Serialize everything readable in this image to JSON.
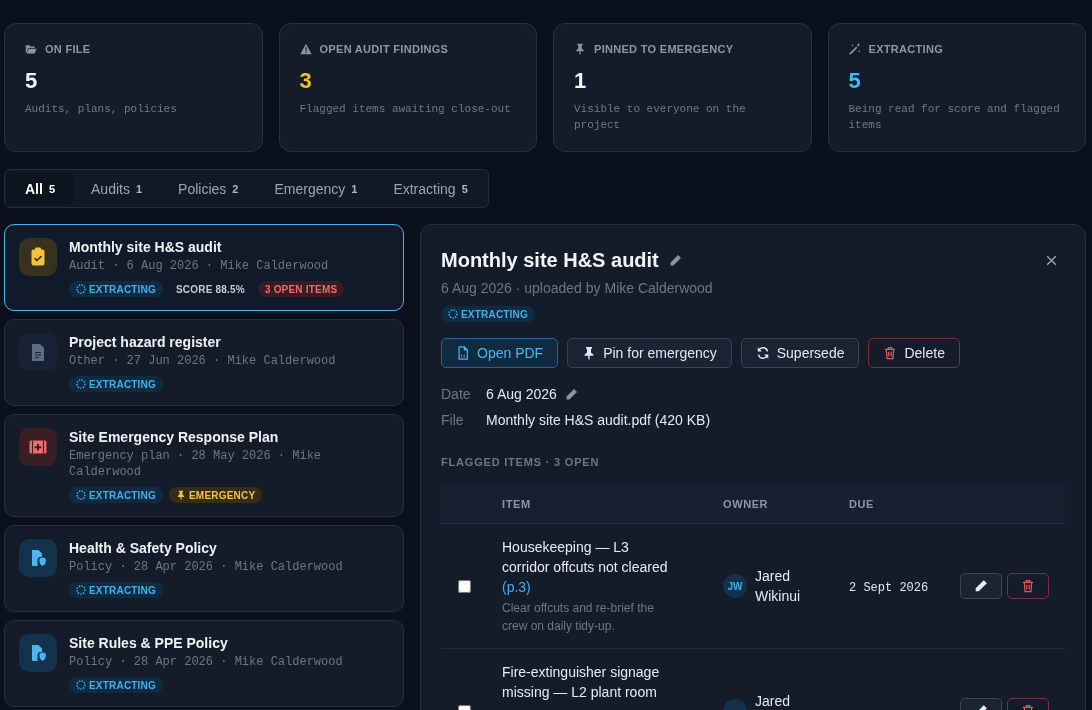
{
  "stats": [
    {
      "kind": "folder",
      "label": "ON FILE",
      "value": "5",
      "color": "#f1f5f9",
      "description": "Audits, plans, policies"
    },
    {
      "kind": "warning",
      "label": "OPEN AUDIT FINDINGS",
      "value": "3",
      "color": "#fbbf24",
      "description": "Flagged items awaiting close-out"
    },
    {
      "kind": "pin",
      "label": "PINNED TO EMERGENCY",
      "value": "1",
      "color": "#f1f5f9",
      "description": "Visible to everyone on the project"
    },
    {
      "kind": "wand",
      "label": "EXTRACTING",
      "value": "5",
      "color": "#38bdf8",
      "description": "Being read for score and flagged items"
    }
  ],
  "filter_tabs": [
    {
      "label": "All",
      "count": "5",
      "selected": true
    },
    {
      "label": "Audits",
      "count": "1",
      "selected": false
    },
    {
      "label": "Policies",
      "count": "2",
      "selected": false
    },
    {
      "label": "Emergency",
      "count": "1",
      "selected": false
    },
    {
      "label": "Extracting",
      "count": "5",
      "selected": false
    }
  ],
  "documents": [
    {
      "kind": "audit",
      "title": "Monthly site H&S audit",
      "meta": "Audit · 6 Aug 2026 · Mike Calderwood",
      "selected": true,
      "badges": [
        {
          "kind": "extracting",
          "text": "EXTRACTING"
        },
        {
          "kind": "score",
          "text": "SCORE 88.5%"
        },
        {
          "kind": "open",
          "text": "3 OPEN ITEMS"
        }
      ]
    },
    {
      "kind": "other",
      "title": "Project hazard register",
      "meta": "Other · 27 Jun 2026 · Mike Calderwood",
      "selected": false,
      "badges": [
        {
          "kind": "extracting",
          "text": "EXTRACTING"
        }
      ]
    },
    {
      "kind": "emergency",
      "title": "Site Emergency Response Plan",
      "meta": "Emergency plan · 28 May 2026 · Mike Calderwood",
      "selected": false,
      "badges": [
        {
          "kind": "extracting",
          "text": "EXTRACTING"
        },
        {
          "kind": "emergency",
          "text": "EMERGENCY"
        }
      ]
    },
    {
      "kind": "policy",
      "title": "Health & Safety Policy",
      "meta": "Policy · 28 Apr 2026 · Mike Calderwood",
      "selected": false,
      "badges": [
        {
          "kind": "extracting",
          "text": "EXTRACTING"
        }
      ]
    },
    {
      "kind": "policy",
      "title": "Site Rules & PPE Policy",
      "meta": "Policy · 28 Apr 2026 · Mike Calderwood",
      "selected": false,
      "badges": [
        {
          "kind": "extracting",
          "text": "EXTRACTING"
        }
      ]
    }
  ],
  "detail": {
    "title": "Monthly site H&S audit",
    "subtitle": "6 Aug 2026 · uploaded by Mike Calderwood",
    "badge": {
      "kind": "extracting",
      "text": "EXTRACTING"
    },
    "actions": [
      {
        "kind": "pdf",
        "label": "Open PDF"
      },
      {
        "kind": "pin",
        "label": "Pin for emergency"
      },
      {
        "kind": "supersede",
        "label": "Supersede"
      },
      {
        "kind": "delete",
        "label": "Delete"
      }
    ],
    "fields": [
      {
        "label": "Date",
        "value": "6 Aug 2026",
        "editable": true
      },
      {
        "label": "File",
        "value": "Monthly site H&S audit.pdf (420 KB)",
        "editable": false
      }
    ],
    "flagged_heading": "FLAGGED ITEMS · 3 OPEN",
    "table": {
      "columns": [
        "ITEM",
        "OWNER",
        "DUE"
      ],
      "rows": [
        {
          "checked": false,
          "title": "Housekeeping — L3 corridor offcuts not cleared",
          "page_ref": "(p.3)",
          "note": "Clear offcuts and re-brief the crew on daily tidy-up.",
          "owner_initials": "JW",
          "owner": "Jared Wikinui",
          "due": "2 Sept 2026"
        },
        {
          "checked": false,
          "title": "Fire-extinguisher signage missing — L2 plant room",
          "owner": "Jared"
        }
      ]
    }
  }
}
